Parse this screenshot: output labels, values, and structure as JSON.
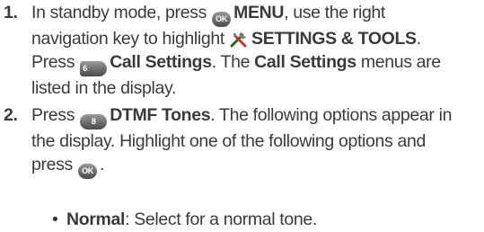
{
  "step1": {
    "num": "1.",
    "line1_a": "In standby mode, press",
    "key_ok_label": "OK",
    "menu": "MENU",
    "line1_b": ", use the right",
    "line2_a": "navigation key to highlight",
    "settings_tools": "SETTINGS & TOOLS",
    "period1": ".",
    "line3_a": "Press",
    "key6_label": "6",
    "call_settings": "Call Settings",
    "line3_b": ". The",
    "call_settings_2": "Call Settings",
    "line3_c": "menus are",
    "line4": "listed in the display."
  },
  "step2": {
    "num": "2.",
    "line1_a": "Press",
    "key8_label": "8",
    "dtmf_tones": "DTMF Tones",
    "line1_b": ". The following options appear in",
    "line2": "the display. Highlight one of the following options and",
    "line3_a": "press",
    "key_ok_label": "OK",
    "period": "."
  },
  "bullet": {
    "dot": "•",
    "label": "Normal",
    "text": ": Select for a normal tone."
  }
}
